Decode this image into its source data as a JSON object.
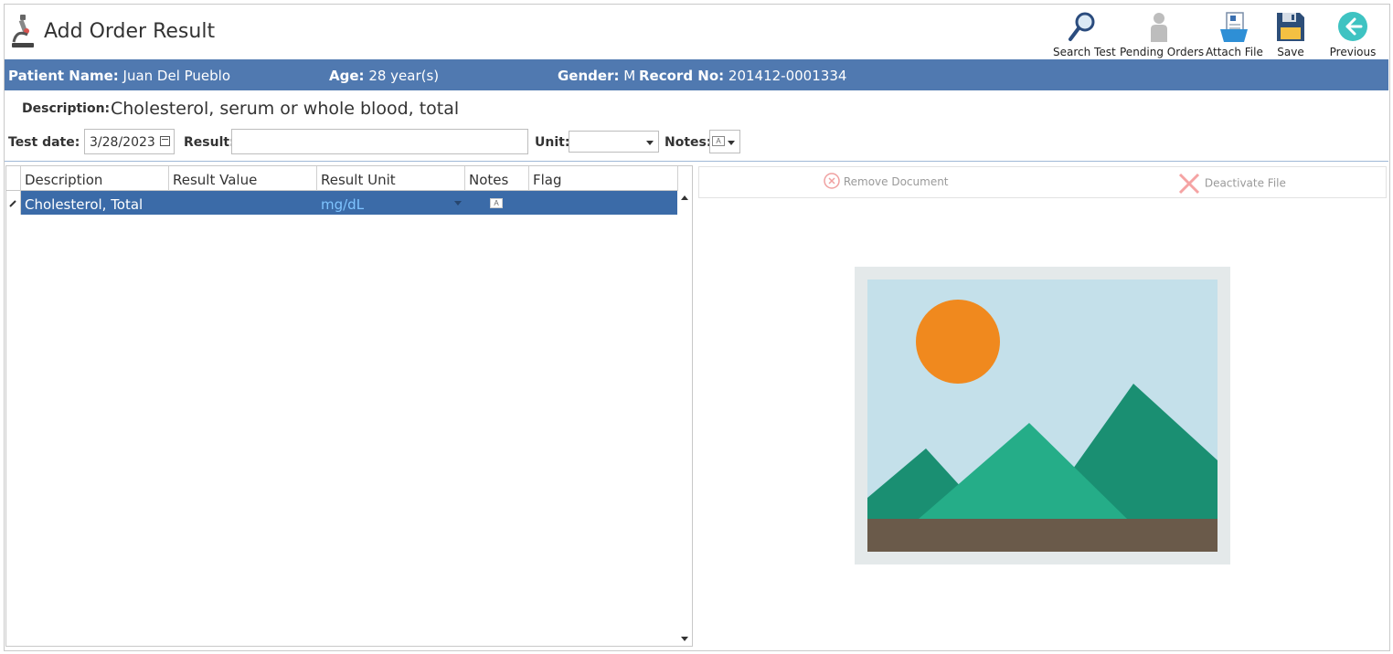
{
  "header": {
    "title": "Add Order Result",
    "toolbar": [
      {
        "label": "Search Test",
        "icon": "search-icon"
      },
      {
        "label": "Pending Orders",
        "icon": "person-icon"
      },
      {
        "label": "Attach File",
        "icon": "attach-file-icon"
      },
      {
        "label": "Save",
        "icon": "save-icon"
      },
      {
        "label": "Previous",
        "icon": "back-arrow-icon"
      }
    ]
  },
  "patient": {
    "name_label": "Patient Name:",
    "name": "Juan Del Pueblo",
    "age_label": "Age:",
    "age": "28 year(s)",
    "gender_label": "Gender:",
    "gender": "M",
    "record_label": "Record No:",
    "record": "201412-0001334"
  },
  "description": {
    "label": "Description:",
    "value": "Cholesterol, serum or whole blood, total"
  },
  "form": {
    "test_date_label": "Test date:",
    "test_date": "3/28/2023",
    "result_label": "Result:",
    "result_value": "",
    "unit_label": "Unit:",
    "unit_value": "",
    "notes_label": "Notes:"
  },
  "grid": {
    "columns": [
      "Description",
      "Result Value",
      "Result Unit",
      "Notes",
      "Flag"
    ],
    "rows": [
      {
        "description": "Cholesterol, Total",
        "result_value": "",
        "result_unit": "mg/dL",
        "notes": "",
        "flag": ""
      }
    ]
  },
  "documents": {
    "remove_label": "Remove Document",
    "deactivate_label": "Deactivate File"
  },
  "colors": {
    "patient_bar": "#5079b0",
    "selected_row": "#3b6ba8",
    "unit_link": "#7fc4ff"
  }
}
